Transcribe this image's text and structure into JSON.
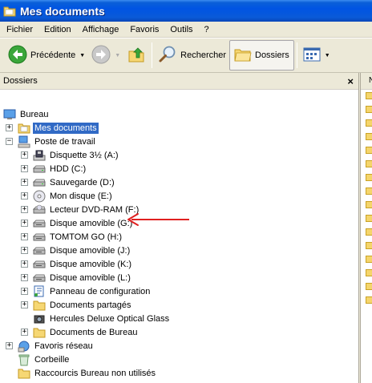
{
  "window": {
    "title": "Mes documents"
  },
  "menu": [
    "Fichier",
    "Edition",
    "Affichage",
    "Favoris",
    "Outils",
    "?"
  ],
  "toolbar": {
    "back_label": "Précédente",
    "search_label": "Rechercher",
    "folders_label": "Dossiers"
  },
  "pane": {
    "title": "Dossiers",
    "close": "×"
  },
  "rightstrip": {
    "header": "N"
  },
  "tree": [
    {
      "label": "Bureau",
      "icon": "desktop-icon",
      "expander": ""
    },
    {
      "label": "Mes documents",
      "icon": "my-documents-icon",
      "expander": "+",
      "selected": true
    },
    {
      "label": "Poste de travail",
      "icon": "my-computer-icon",
      "expander": "−"
    },
    {
      "label": "Disquette 3½ (A:)",
      "icon": "floppy-drive-icon",
      "expander": "+"
    },
    {
      "label": "HDD (C:)",
      "icon": "hard-drive-icon",
      "expander": "+"
    },
    {
      "label": "Sauvegarde (D:)",
      "icon": "hard-drive-icon",
      "expander": "+"
    },
    {
      "label": "Mon disque (E:)",
      "icon": "cd-drive-icon",
      "expander": "+"
    },
    {
      "label": "Lecteur DVD-RAM (F:)",
      "icon": "dvd-drive-icon",
      "expander": "+"
    },
    {
      "label": "Disque amovible (G:)",
      "icon": "removable-drive-icon",
      "expander": "+"
    },
    {
      "label": "TOMTOM GO (H:)",
      "icon": "removable-drive-icon",
      "expander": "+"
    },
    {
      "label": "Disque amovible (J:)",
      "icon": "removable-drive-icon",
      "expander": "+"
    },
    {
      "label": "Disque amovible (K:)",
      "icon": "removable-drive-icon",
      "expander": "+"
    },
    {
      "label": "Disque amovible (L:)",
      "icon": "removable-drive-icon",
      "expander": "+"
    },
    {
      "label": "Panneau de configuration",
      "icon": "control-panel-icon",
      "expander": "+"
    },
    {
      "label": "Documents partagés",
      "icon": "folder-icon",
      "expander": "+"
    },
    {
      "label": "Hercules Deluxe Optical Glass",
      "icon": "camera-icon",
      "expander": ""
    },
    {
      "label": "Documents de Bureau",
      "icon": "folder-icon",
      "expander": "+"
    },
    {
      "label": "Favoris réseau",
      "icon": "network-places-icon",
      "expander": "+"
    },
    {
      "label": "Corbeille",
      "icon": "recycle-bin-icon",
      "expander": ""
    },
    {
      "label": "Raccourcis Bureau non utilisés",
      "icon": "folder-icon",
      "expander": ""
    }
  ],
  "colors": {
    "titlebar": "#0054e3",
    "selection": "#316ac5",
    "annotation_arrow": "#e02020"
  }
}
